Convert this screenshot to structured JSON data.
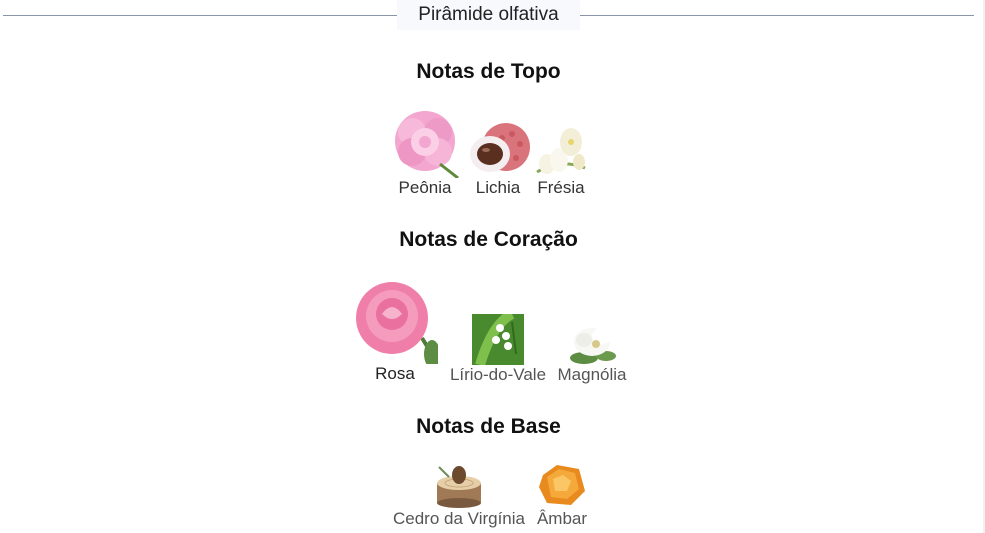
{
  "section_title": "Pirâmide olfativa",
  "top": {
    "heading": "Notas de Topo",
    "notes": [
      {
        "label": "Peônia",
        "icon": "peony-icon"
      },
      {
        "label": "Lichia",
        "icon": "lychee-icon"
      },
      {
        "label": "Frésia",
        "icon": "freesia-icon"
      }
    ]
  },
  "heart": {
    "heading": "Notas de Coração",
    "notes": [
      {
        "label": "Rosa",
        "icon": "rose-icon"
      },
      {
        "label": "Lírio-do-Vale",
        "icon": "lily-of-the-valley-icon"
      },
      {
        "label": "Magnólia",
        "icon": "magnolia-icon"
      }
    ]
  },
  "base": {
    "heading": "Notas de Base",
    "notes": [
      {
        "label": "Cedro da Virgínia",
        "icon": "cedar-icon"
      },
      {
        "label": "Âmbar",
        "icon": "amber-icon"
      }
    ]
  }
}
